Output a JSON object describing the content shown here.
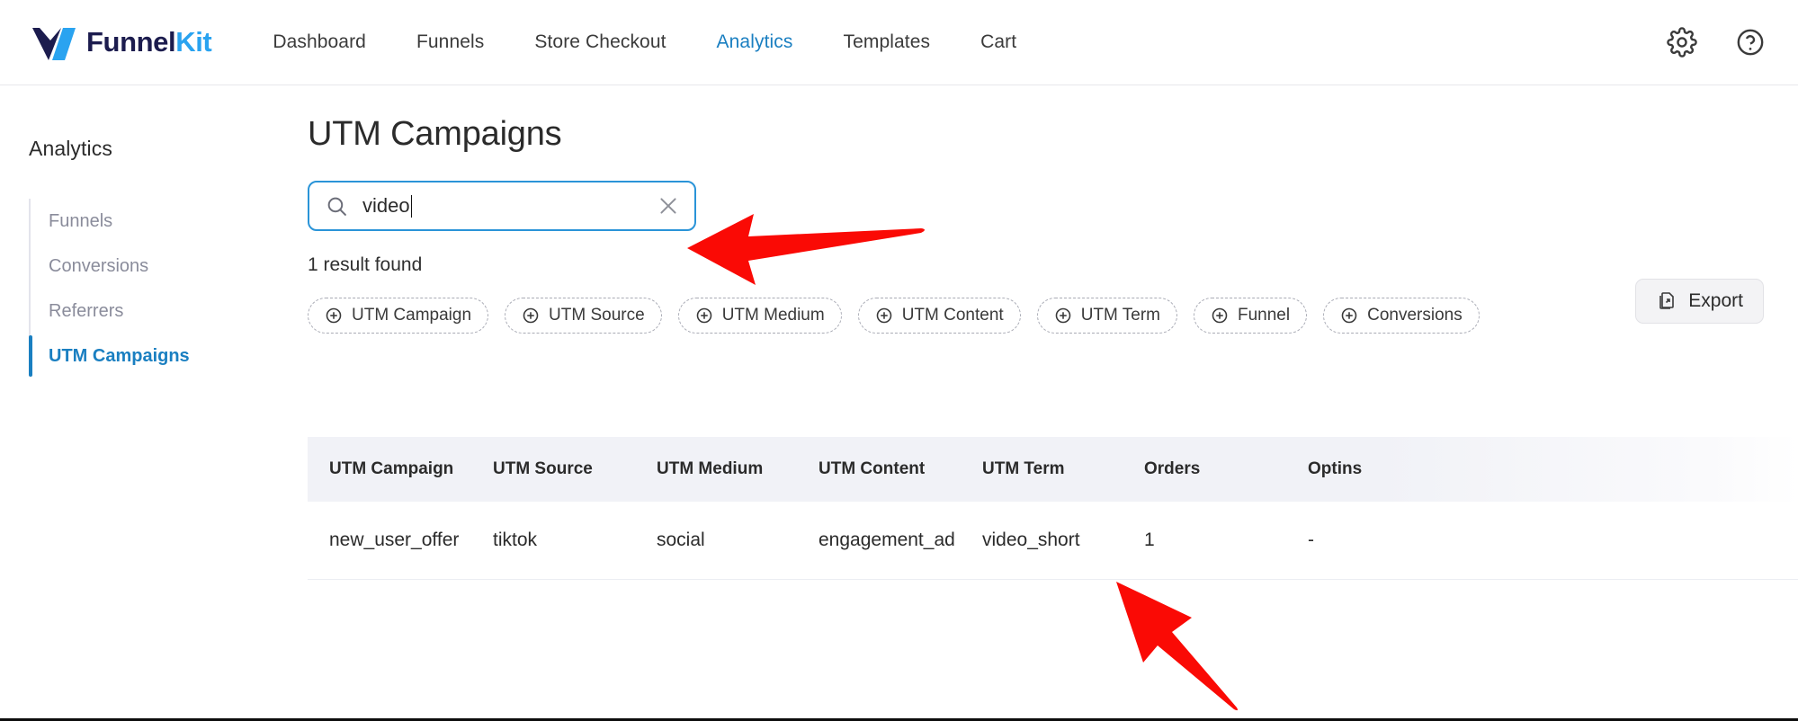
{
  "brand": {
    "name_dark": "Funnel",
    "name_accent": "Kit",
    "logo_icon": "funnelkit-logo-icon"
  },
  "topnav": {
    "items": [
      {
        "label": "Dashboard",
        "active": false
      },
      {
        "label": "Funnels",
        "active": false
      },
      {
        "label": "Store Checkout",
        "active": false
      },
      {
        "label": "Analytics",
        "active": true
      },
      {
        "label": "Templates",
        "active": false
      },
      {
        "label": "Cart",
        "active": false
      }
    ],
    "icons": [
      {
        "name": "gear-icon",
        "label": "Settings"
      },
      {
        "name": "help-circle-icon",
        "label": "Help"
      }
    ]
  },
  "sidebar": {
    "title": "Analytics",
    "items": [
      {
        "label": "Funnels",
        "active": false
      },
      {
        "label": "Conversions",
        "active": false
      },
      {
        "label": "Referrers",
        "active": false
      },
      {
        "label": "UTM Campaigns",
        "active": true
      }
    ]
  },
  "main": {
    "page_title": "UTM Campaigns",
    "search": {
      "value": "video",
      "placeholder": "Search",
      "icon": "search-icon",
      "clear_icon": "close-x-icon"
    },
    "result_count": "1 result found",
    "export": {
      "label": "Export",
      "icon": "export-document-icon"
    },
    "filter_chips": [
      {
        "label": "UTM Campaign"
      },
      {
        "label": "UTM Source"
      },
      {
        "label": "UTM Medium"
      },
      {
        "label": "UTM Content"
      },
      {
        "label": "UTM Term"
      },
      {
        "label": "Funnel"
      },
      {
        "label": "Conversions"
      }
    ],
    "table": {
      "columns": [
        "UTM Campaign",
        "UTM Source",
        "UTM Medium",
        "UTM Content",
        "UTM Term",
        "Orders",
        "Optins"
      ],
      "rows": [
        {
          "utm_campaign": "new_user_offer",
          "utm_source": "tiktok",
          "utm_medium": "social",
          "utm_content": "engagement_ad",
          "utm_term": "video_short",
          "orders": "1",
          "optins": "-"
        }
      ]
    }
  },
  "annotations": {
    "arrows": [
      {
        "name": "arrow-pointing-to-search-box",
        "color": "#FA0A05",
        "direction": "left"
      },
      {
        "name": "arrow-pointing-to-table-row",
        "color": "#FA0A05",
        "direction": "up-left"
      }
    ]
  },
  "colors": {
    "accent_blue": "#1a7fc1",
    "brand_light_blue": "#2aa3f0",
    "brand_dark": "#1c1c4e",
    "annotation_red": "#FA0A05",
    "table_header_bg": "#f1f2f7"
  }
}
